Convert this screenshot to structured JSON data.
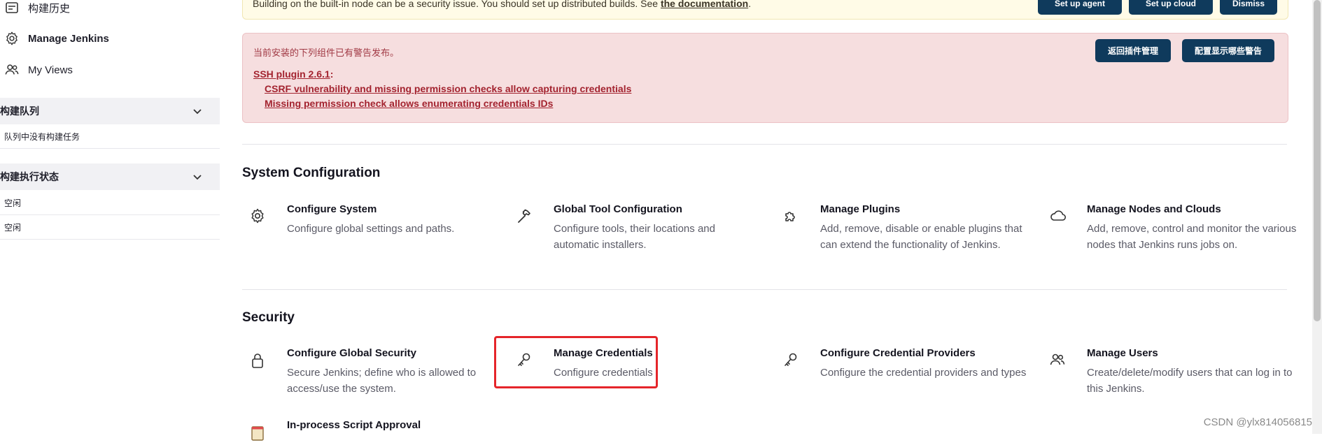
{
  "sidebar": {
    "build_history": "构建历史",
    "manage_jenkins": "Manage Jenkins",
    "my_views": "My Views",
    "build_queue": {
      "title": "构建队列",
      "empty": "队列中没有构建任务"
    },
    "executors": {
      "title": "构建执行状态",
      "rows": [
        "空闲",
        "空闲"
      ]
    }
  },
  "notice": {
    "text": "Building on the built-in node can be a security issue. You should set up distributed builds. See ",
    "link": "the documentation",
    "suffix": ".",
    "buttons": [
      "Set up agent",
      "Set up cloud",
      "Dismiss"
    ]
  },
  "warning": {
    "intro": "当前安装的下列组件已有警告发布。",
    "plugin": "SSH plugin 2.6.1",
    "plugin_suffix": ":",
    "vulns": [
      "CSRF vulnerability and missing permission checks allow capturing credentials",
      "Missing permission check allows enumerating credentials IDs"
    ],
    "buttons": [
      "返回插件管理",
      "配置显示哪些警告"
    ]
  },
  "system_configuration": {
    "title": "System Configuration",
    "items": [
      {
        "icon": "gear-icon",
        "title": "Configure System",
        "desc": "Configure global settings and paths."
      },
      {
        "icon": "hammer-icon",
        "title": "Global Tool Configuration",
        "desc": "Configure tools, their locations and automatic installers."
      },
      {
        "icon": "puzzle-icon",
        "title": "Manage Plugins",
        "desc": "Add, remove, disable or enable plugins that can extend the functionality of Jenkins."
      },
      {
        "icon": "cloud-icon",
        "title": "Manage Nodes and Clouds",
        "desc": "Add, remove, control and monitor the various nodes that Jenkins runs jobs on."
      }
    ]
  },
  "security": {
    "title": "Security",
    "items": [
      {
        "icon": "lock-icon",
        "title": "Configure Global Security",
        "desc": "Secure Jenkins; define who is allowed to access/use the system."
      },
      {
        "icon": "key-icon",
        "title": "Manage Credentials",
        "desc": "Configure credentials"
      },
      {
        "icon": "key-icon",
        "title": "Configure Credential Providers",
        "desc": "Configure the credential providers and types"
      },
      {
        "icon": "users-icon",
        "title": "Manage Users",
        "desc": "Create/delete/modify users that can log in to this Jenkins."
      },
      {
        "icon": "script-icon",
        "title": "In-process Script Approval",
        "desc": ""
      }
    ]
  },
  "watermark": "CSDN @ylx814056815",
  "colors": {
    "accent": "#0f3a5c",
    "warning_bg": "#f6dedf",
    "warning_text": "#a3232f",
    "highlight": "#e5252a"
  }
}
